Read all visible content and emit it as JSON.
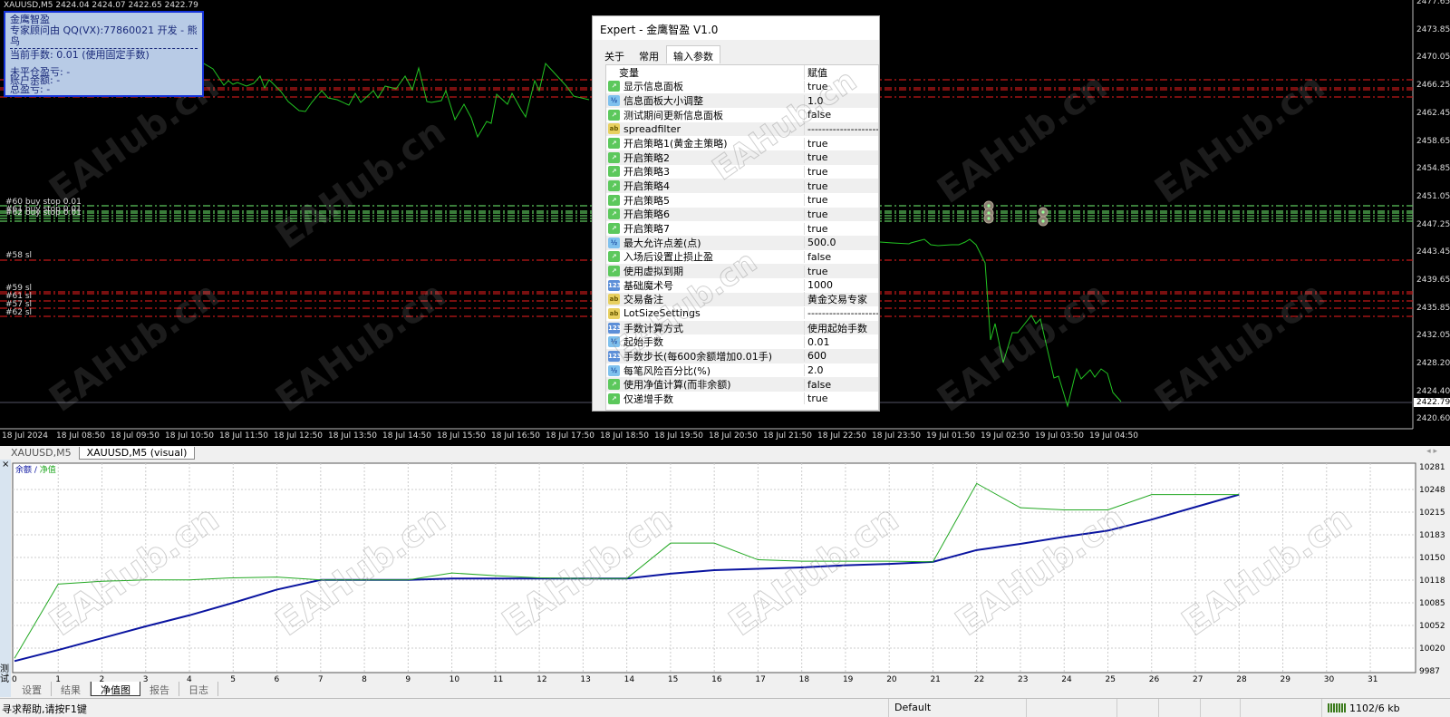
{
  "chart": {
    "header": "XAUUSD,M5  2424.04 2424.07 2422.65 2422.79",
    "price_labels": [
      "2477.65",
      "2473.85",
      "2470.05",
      "2466.25",
      "2462.45",
      "2458.65",
      "2454.85",
      "2451.05",
      "2447.25",
      "2443.45",
      "2439.65",
      "2435.85",
      "2432.05",
      "2428.20",
      "2424.40",
      "2420.60"
    ],
    "current_price": "2422.79",
    "time_labels": [
      "18 Jul 2024",
      "18 Jul 08:50",
      "18 Jul 09:50",
      "18 Jul 10:50",
      "18 Jul 11:50",
      "18 Jul 12:50",
      "18 Jul 13:50",
      "18 Jul 14:50",
      "18 Jul 15:50",
      "18 Jul 16:50",
      "18 Jul 17:50",
      "18 Jul 18:50",
      "18 Jul 19:50",
      "18 Jul 20:50",
      "18 Jul 21:50",
      "18 Jul 22:50",
      "18 Jul 23:50",
      "19 Jul 01:50",
      "19 Jul 02:50",
      "19 Jul 03:50",
      "19 Jul 04:50"
    ],
    "order_labels": [
      "#60 buy stop 0.01",
      "#61 buy stop 0.01",
      "#62 buy stop 0.01",
      "#58 sl",
      "#59 sl",
      "#61 sl",
      "#57 sl",
      "#62 sl"
    ],
    "colors": {
      "price_line": "#22c422",
      "sl_line": "#c01818",
      "order_line": "#5cc85c"
    }
  },
  "info_panel": {
    "title": "金鹰智盈",
    "developer": "专家顾问由 QQ(VX):77860021 开发 - 熊鸟",
    "lots": "当前手数: 0.01 (使用固定手数)",
    "open_pnl": "未平仓盈亏: -",
    "balance": "账户余额: -",
    "total_pnl": "总盈亏: -"
  },
  "dialog": {
    "title": "Expert - 金鹰智盈 V1.0",
    "tabs": [
      "关于",
      "常用",
      "输入参数"
    ],
    "col_variable": "变量",
    "col_value": "赋值",
    "params": [
      {
        "type": "bool",
        "name": "显示信息面板",
        "value": "true"
      },
      {
        "type": "dbl",
        "name": "信息面板大小调整",
        "value": "1.0"
      },
      {
        "type": "bool",
        "name": "测试期间更新信息面板",
        "value": "false"
      },
      {
        "type": "str",
        "name": "spreadfilter",
        "value": "------------------------"
      },
      {
        "type": "bool",
        "name": "开启策略1(黄金主策略)",
        "value": "true"
      },
      {
        "type": "bool",
        "name": "开启策略2",
        "value": "true"
      },
      {
        "type": "bool",
        "name": "开启策略3",
        "value": "true"
      },
      {
        "type": "bool",
        "name": "开启策略4",
        "value": "true"
      },
      {
        "type": "bool",
        "name": "开启策略5",
        "value": "true"
      },
      {
        "type": "bool",
        "name": "开启策略6",
        "value": "true"
      },
      {
        "type": "bool",
        "name": "开启策略7",
        "value": "true"
      },
      {
        "type": "dbl",
        "name": "最大允许点差(点)",
        "value": "500.0"
      },
      {
        "type": "bool",
        "name": "入场后设置止损止盈",
        "value": "false"
      },
      {
        "type": "bool",
        "name": "使用虚拟到期",
        "value": "true"
      },
      {
        "type": "int",
        "name": "基础魔术号",
        "value": "1000"
      },
      {
        "type": "str",
        "name": "交易备注",
        "value": "黄金交易专家"
      },
      {
        "type": "str",
        "name": "LotSizeSettings",
        "value": "------------------------"
      },
      {
        "type": "int",
        "name": "手数计算方式",
        "value": "使用起始手数"
      },
      {
        "type": "dbl",
        "name": "起始手数",
        "value": "0.01"
      },
      {
        "type": "int",
        "name": "手数步长(每600余额增加0.01手)",
        "value": "600"
      },
      {
        "type": "dbl",
        "name": "每笔风险百分比(%)",
        "value": "2.0"
      },
      {
        "type": "bool",
        "name": "使用净值计算(而非余额)",
        "value": "false"
      },
      {
        "type": "bool",
        "name": "仅递增手数",
        "value": "true"
      }
    ]
  },
  "icon_glyphs": {
    "bool": "↗",
    "dbl": "½",
    "int": "123",
    "str": "ab"
  },
  "window_tabs": [
    "XAUUSD,M5",
    "XAUUSD,M5 (visual)"
  ],
  "tester": {
    "side_label": "测试",
    "close": "×",
    "tabs": [
      "设置",
      "结果",
      "净值图",
      "报告",
      "日志"
    ],
    "legend_balance": "余额",
    "legend_sep": " / ",
    "legend_equity": "净值"
  },
  "chart_data": {
    "type": "line",
    "title": "余额 / 净值",
    "x": [
      0,
      1,
      2,
      3,
      4,
      5,
      6,
      7,
      8,
      9,
      10,
      11,
      12,
      13,
      14,
      15,
      16,
      17,
      18,
      19,
      20,
      21,
      22,
      23,
      24,
      25,
      26,
      27,
      28
    ],
    "x_ticks": [
      0,
      1,
      2,
      3,
      4,
      5,
      6,
      7,
      8,
      9,
      10,
      11,
      12,
      13,
      14,
      15,
      16,
      17,
      18,
      19,
      20,
      21,
      22,
      23,
      24,
      25,
      26,
      27,
      28,
      29,
      30,
      31
    ],
    "y_ticks": [
      "10281",
      "10248",
      "10215",
      "10183",
      "10150",
      "10118",
      "10085",
      "10052",
      "10020",
      "9987"
    ],
    "ylim": [
      9987,
      10281
    ],
    "xlim": [
      0,
      31
    ],
    "series": [
      {
        "name": "余额",
        "color": "#0a14a0",
        "values": [
          10001,
          10017,
          10034,
          10051,
          10067,
          10085,
          10104,
          10118,
          10118,
          10118,
          10120,
          10120,
          10120,
          10120,
          10120,
          10127,
          10132,
          10134,
          10136,
          10139,
          10141,
          10144,
          10161,
          10170,
          10180,
          10189,
          10205,
          10223,
          10241
        ]
      },
      {
        "name": "净值",
        "color": "#22a822",
        "values": [
          10005,
          10112,
          10116,
          10118,
          10118,
          10121,
          10122,
          10118,
          10118,
          10118,
          10128,
          10124,
          10121,
          10120,
          10120,
          10171,
          10171,
          10147,
          10145,
          10145,
          10145,
          10144,
          10257,
          10222,
          10219,
          10219,
          10241,
          10241,
          10241
        ]
      }
    ]
  },
  "status": {
    "help": "寻求帮助,请按F1键",
    "profile": "Default",
    "traffic": "1102/6 kb"
  },
  "watermark": "EAHub.cn"
}
